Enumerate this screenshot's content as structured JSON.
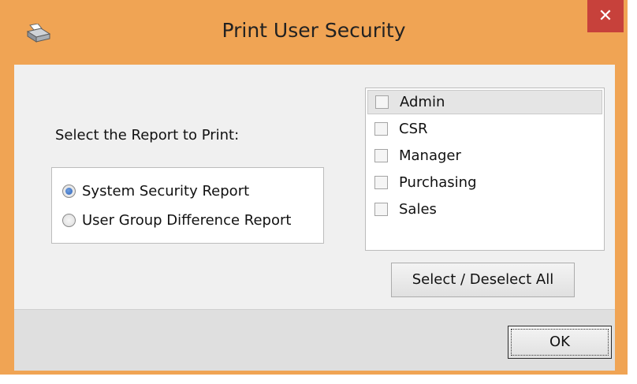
{
  "window": {
    "title": "Print User Security",
    "close_glyph": "✕",
    "accent_color": "#f0a454",
    "close_color": "#c7413b",
    "icon": "printer-icon"
  },
  "report": {
    "prompt": "Select the Report to Print:",
    "options": [
      {
        "label": "System Security Report",
        "selected": true
      },
      {
        "label": "User Group Difference Report",
        "selected": false
      }
    ]
  },
  "groups": {
    "items": [
      {
        "label": "Admin",
        "checked": false,
        "highlighted": true
      },
      {
        "label": "CSR",
        "checked": false,
        "highlighted": false
      },
      {
        "label": "Manager",
        "checked": false,
        "highlighted": false
      },
      {
        "label": "Purchasing",
        "checked": false,
        "highlighted": false
      },
      {
        "label": "Sales",
        "checked": false,
        "highlighted": false
      }
    ],
    "select_all_label": "Select / Deselect All"
  },
  "footer": {
    "ok_label": "OK"
  }
}
